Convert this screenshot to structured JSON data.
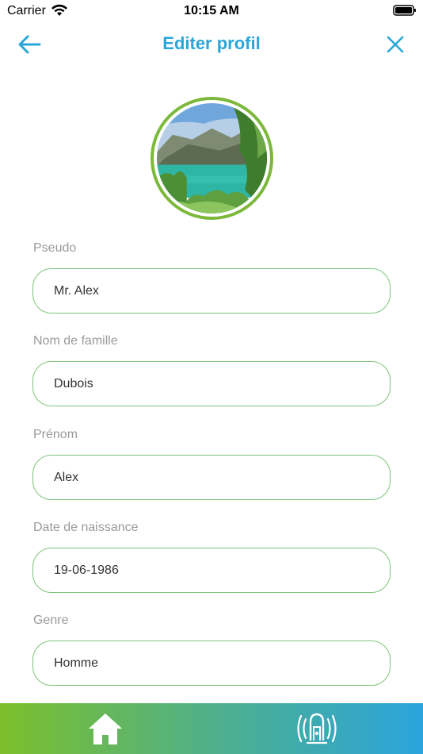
{
  "status_bar": {
    "carrier": "Carrier",
    "time": "10:15 AM"
  },
  "header": {
    "title": "Editer profil",
    "back_icon": "arrow-left-icon",
    "close_icon": "close-icon",
    "accent_color": "#2aa6d9"
  },
  "avatar": {
    "border_color": "#7cb83a",
    "image": "lake landscape"
  },
  "form": {
    "fields": [
      {
        "label": "Pseudo",
        "value": "Mr. Alex"
      },
      {
        "label": "Nom de famille",
        "value": "Dubois"
      },
      {
        "label": "Prénom",
        "value": "Alex"
      },
      {
        "label": "Date de naissance",
        "value": "19-06-1986"
      },
      {
        "label": "Genre",
        "value": "Homme"
      }
    ],
    "border_color": "#7fc47a"
  },
  "tab_bar": {
    "items": [
      {
        "icon": "home-icon"
      },
      {
        "icon": "device-signal-icon"
      }
    ],
    "gradient_start": "#7cbf2a",
    "gradient_end": "#2aa4dc"
  }
}
